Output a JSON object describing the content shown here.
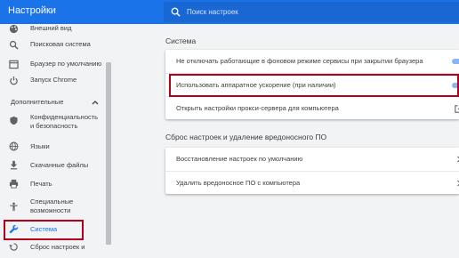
{
  "header": {
    "title": "Настройки",
    "search_placeholder": "Поиск настроек"
  },
  "sidebar": {
    "items_top": [
      {
        "label": "Внешний вид",
        "icon": "palette-icon"
      },
      {
        "label": "Поисковая система",
        "icon": "search-icon"
      },
      {
        "label": "Браузер по умолчанию",
        "icon": "browser-icon"
      },
      {
        "label": "Запуск Chrome",
        "icon": "power-icon"
      }
    ],
    "section_label": "Дополнительные",
    "items_advanced": [
      {
        "label": "Конфиденциальность и безопасность",
        "icon": "shield-icon"
      },
      {
        "label": "Языки",
        "icon": "globe-icon"
      },
      {
        "label": "Скачанные файлы",
        "icon": "download-icon"
      },
      {
        "label": "Печать",
        "icon": "printer-icon"
      },
      {
        "label": "Специальные возможности",
        "icon": "accessibility-icon"
      },
      {
        "label": "Система",
        "icon": "wrench-icon"
      },
      {
        "label": "Сброс настроек и",
        "icon": "reset-icon"
      }
    ]
  },
  "main": {
    "system": {
      "title": "Система",
      "rows": [
        {
          "label": "Не отключать работающие в фоновом режиме сервисы при закрытии браузера",
          "control": "toggle",
          "state": "on"
        },
        {
          "label": "Использовать аппаратное ускорение (при наличии)",
          "control": "toggle",
          "state": "on"
        },
        {
          "label": "Открыть настройки прокси-сервера для компьютера",
          "control": "external-link-icon"
        }
      ]
    },
    "reset": {
      "title": "Сброс настроек и удаление вредоносного ПО",
      "rows": [
        {
          "label": "Восстановление настроек по умолчанию",
          "control": "chevron-right-icon"
        },
        {
          "label": "Удалить вредоносное ПО с компьютера",
          "control": "chevron-right-icon"
        }
      ]
    }
  },
  "colors": {
    "header_bg": "#1a73e8",
    "accent": "#1a73e8",
    "highlight_border": "#b3001b",
    "page_bg": "#f1f3f4"
  }
}
